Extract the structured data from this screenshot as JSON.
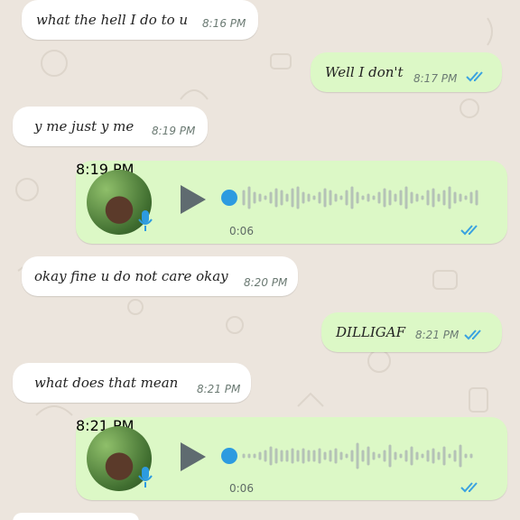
{
  "colors": {
    "incoming": "#ffffff",
    "outgoing": "#dcf8c6",
    "tick_blue": "#3aa2e0",
    "voice_dot": "#2d9be0"
  },
  "messages": [
    {
      "direction": "in",
      "text": "what the hell I do to u",
      "time": "8:16 PM"
    },
    {
      "direction": "out",
      "text": "Well I don't",
      "time": "8:17 PM",
      "status": "read"
    },
    {
      "direction": "in",
      "text": "y me just y me",
      "time": "8:19 PM"
    },
    {
      "direction": "out",
      "type": "voice",
      "duration": "0:06",
      "time": "8:19 PM",
      "status": "read",
      "icons": [
        "avatar",
        "microphone-icon",
        "play-icon"
      ]
    },
    {
      "direction": "in",
      "text": "okay fine u do not care okay",
      "time": "8:20 PM"
    },
    {
      "direction": "out",
      "text": "DILLIGAF",
      "time": "8:21 PM",
      "status": "read"
    },
    {
      "direction": "in",
      "text": "what does that mean",
      "time": "8:21 PM"
    },
    {
      "direction": "out",
      "type": "voice",
      "duration": "0:06",
      "time": "8:21 PM",
      "status": "read",
      "icons": [
        "avatar",
        "microphone-icon",
        "play-icon"
      ]
    }
  ]
}
